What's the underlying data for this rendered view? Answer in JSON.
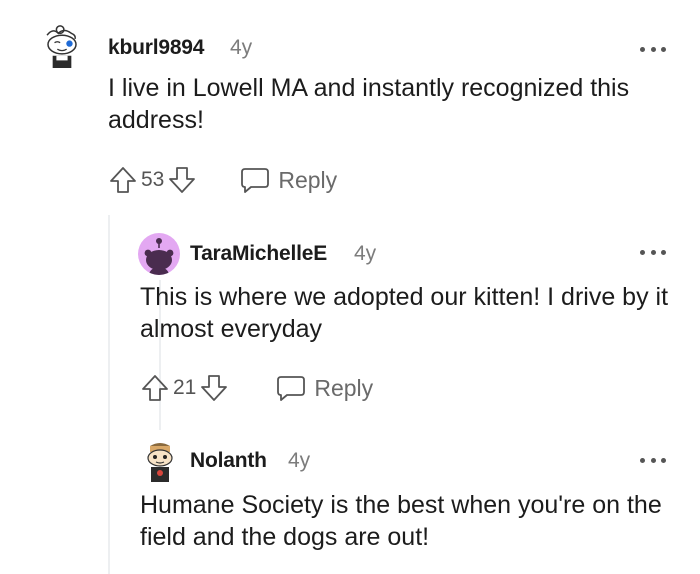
{
  "comments": [
    {
      "author": "kburl9894",
      "age": "4y",
      "text": "I live in Lowell MA and instantly recognized this address!",
      "score": "53",
      "reply_label": "Reply",
      "avatar_icon": "snoo-avatar-icon"
    },
    {
      "author": "TaraMichelleE",
      "age": "4y",
      "text": "This is where we adopted our kitten! I drive by it almost everyday",
      "score": "21",
      "reply_label": "Reply",
      "avatar_icon": "default-snoo-avatar-icon"
    },
    {
      "author": "Nolanth",
      "age": "4y",
      "text": "Humane Society is the best when you're on the field and the dogs are out!",
      "avatar_icon": "snoo-avatar-icon"
    }
  ],
  "colors": {
    "thread_line": "#edeff1",
    "tara_avatar_bg": "#e3a8f2",
    "meta_gray": "#7c7c7c"
  }
}
